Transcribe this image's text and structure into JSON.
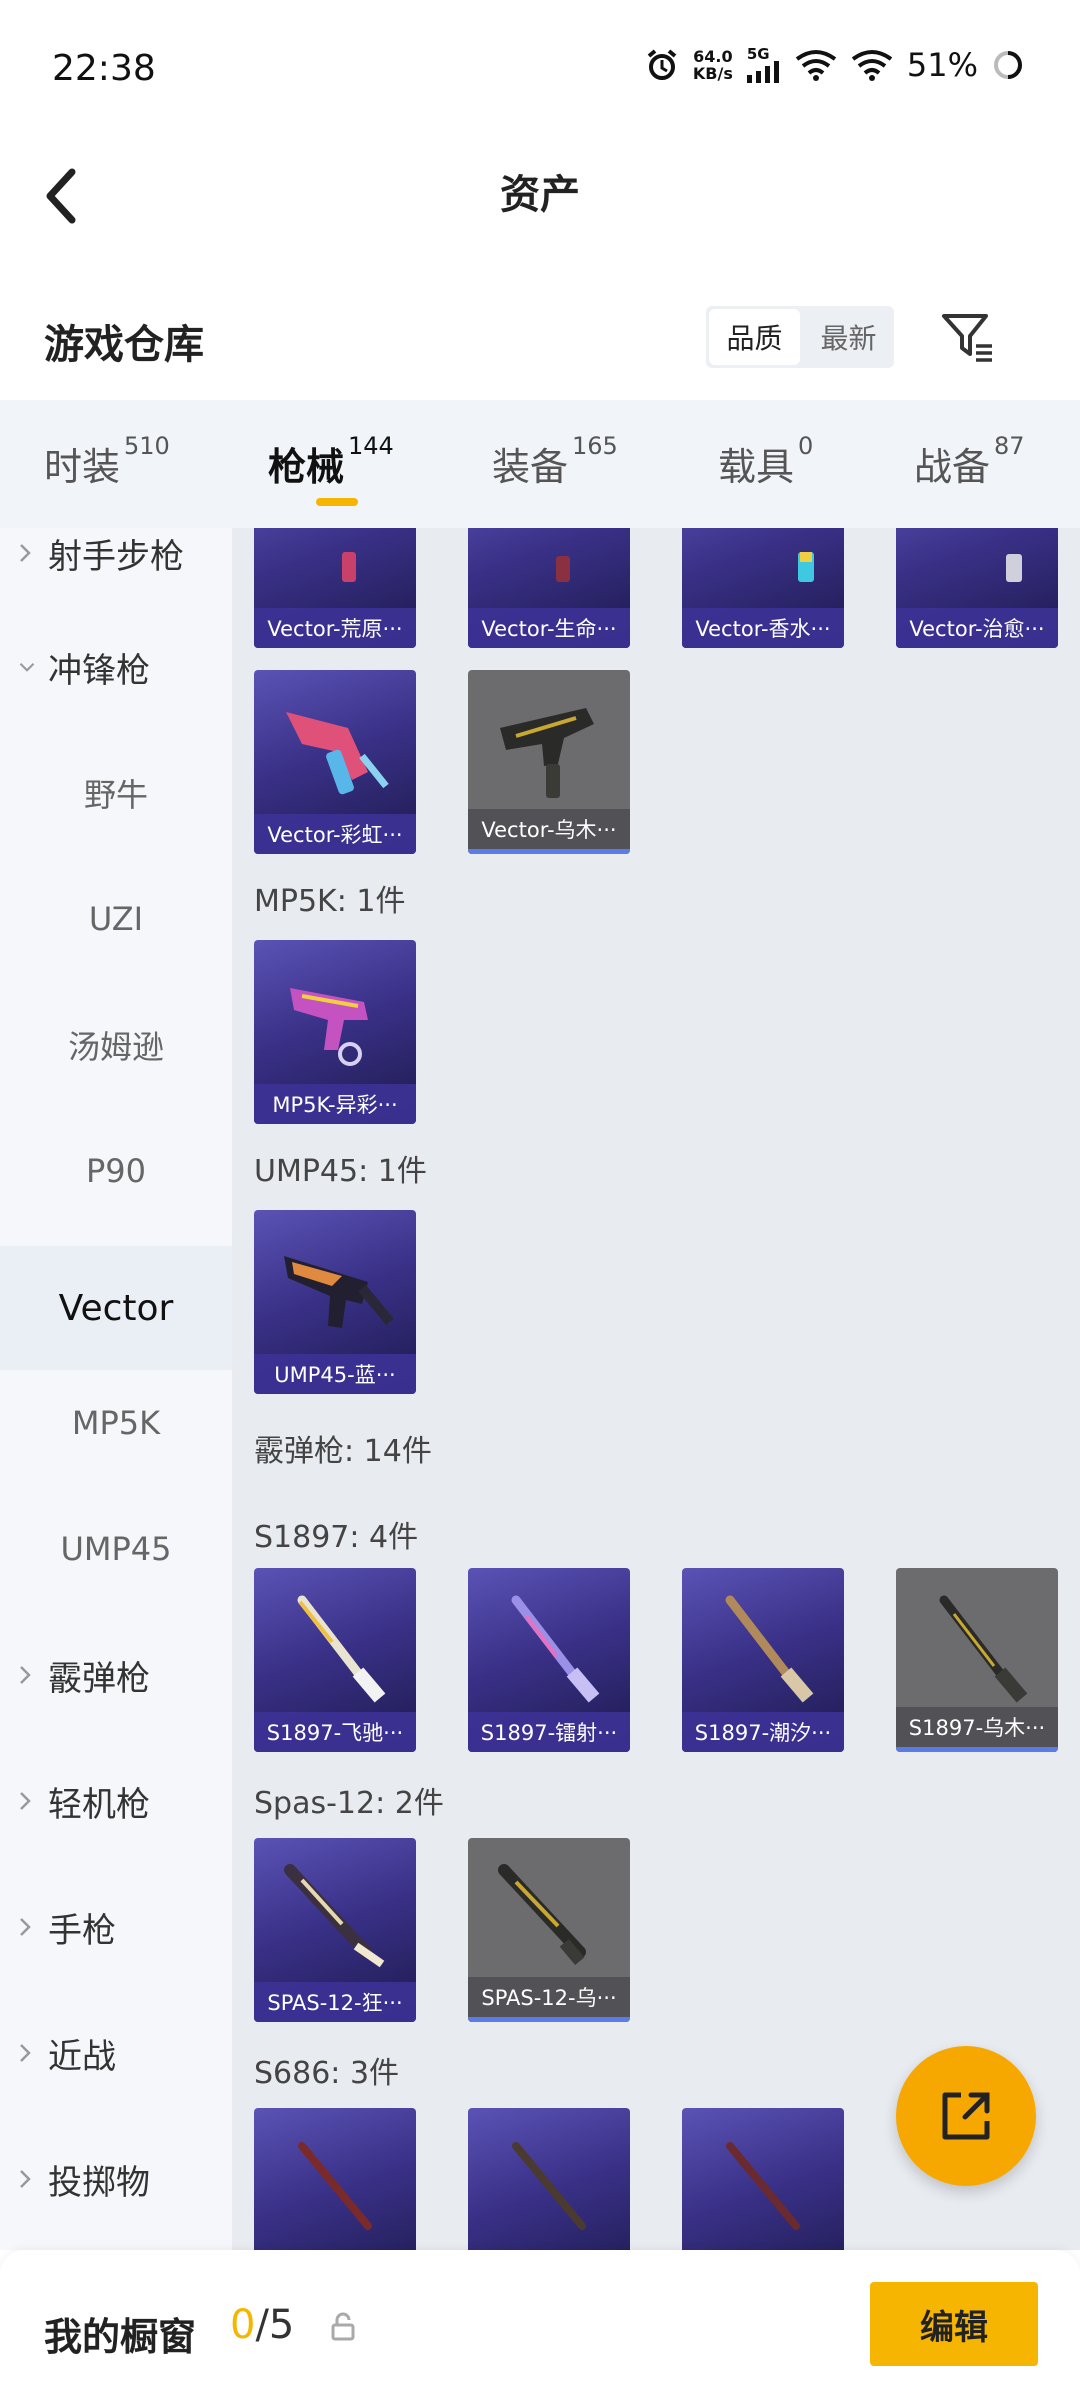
{
  "status": {
    "time": "22:38",
    "net_speed_top": "64.0",
    "net_speed_bottom": "KB/s",
    "signal_label": "5G",
    "battery": "51%"
  },
  "header": {
    "title": "资产"
  },
  "warehouse": {
    "title": "游戏仓库",
    "sort_options": [
      "品质",
      "最新"
    ],
    "active_sort": "品质"
  },
  "tabs": [
    {
      "label": "时装",
      "count": "510"
    },
    {
      "label": "枪械",
      "count": "144",
      "active": true
    },
    {
      "label": "装备",
      "count": "165"
    },
    {
      "label": "载具",
      "count": "0"
    },
    {
      "label": "战备",
      "count": "87"
    }
  ],
  "sidebar": {
    "items": [
      {
        "label": "射手步枪",
        "type": "category"
      },
      {
        "label": "冲锋枪",
        "type": "category",
        "expanded": true
      },
      {
        "label": "野牛",
        "type": "sub"
      },
      {
        "label": "UZI",
        "type": "sub"
      },
      {
        "label": "汤姆逊",
        "type": "sub"
      },
      {
        "label": "P90",
        "type": "sub"
      },
      {
        "label": "Vector",
        "type": "sub",
        "selected": true
      },
      {
        "label": "MP5K",
        "type": "sub"
      },
      {
        "label": "UMP45",
        "type": "sub"
      },
      {
        "label": "霰弹枪",
        "type": "category"
      },
      {
        "label": "轻机枪",
        "type": "category"
      },
      {
        "label": "手枪",
        "type": "category"
      },
      {
        "label": "近战",
        "type": "category"
      },
      {
        "label": "投掷物",
        "type": "category"
      }
    ]
  },
  "content": {
    "vector_row1": [
      "Vector-荒原···",
      "Vector-生命···",
      "Vector-香水···",
      "Vector-治愈···"
    ],
    "vector_row2": [
      "Vector-彩虹···",
      "Vector-乌木···"
    ],
    "mp5k_label": "MP5K: 1件",
    "mp5k_items": [
      "MP5K-异彩···"
    ],
    "ump45_label": "UMP45: 1件",
    "ump45_items": [
      "UMP45-蓝···"
    ],
    "shotgun_label": "霰弹枪: 14件",
    "s1897_label": "S1897: 4件",
    "s1897_items": [
      "S1897-飞驰···",
      "S1897-镭射···",
      "S1897-潮汐···",
      "S1897-乌木···"
    ],
    "spas_label": "Spas-12: 2件",
    "spas_items": [
      "SPAS-12-狂···",
      "SPAS-12-乌···"
    ],
    "s686_label": "S686: 3件"
  },
  "bottom": {
    "showcase_label": "我的橱窗",
    "current": "0",
    "total": "/5",
    "edit_label": "编辑"
  },
  "colors": {
    "accent": "#f5b500",
    "card_purple": "#3a3188",
    "card_gray": "#6c6c6e"
  },
  "icons": [
    "alarm-icon",
    "signal-icon",
    "wifi-icon",
    "battery-icon",
    "back-icon",
    "filter-icon",
    "chevron-right-icon",
    "chevron-down-icon",
    "share-icon",
    "lock-icon"
  ]
}
